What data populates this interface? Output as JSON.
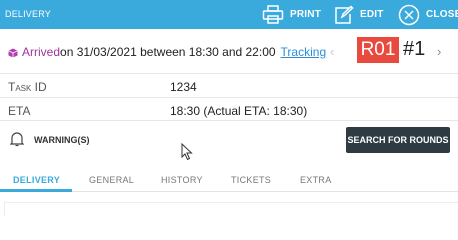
{
  "header": {
    "title": "DELIVERY",
    "print_label": "PRINT",
    "edit_label": "EDIT",
    "close_label": "CLOSE"
  },
  "status": {
    "state": "Arrived",
    "detail": " on 31/03/2021 between 18:30 and 22:00",
    "tracking_link": "Tracking"
  },
  "route": {
    "badge": "R01",
    "number": "#1",
    "prev_icon": "‹",
    "next_icon": "›"
  },
  "fields": {
    "task_id_label": "Task ID",
    "task_id_value": "1234",
    "eta_label": "ETA",
    "eta_value": "18:30 (Actual ETA: 18:30)"
  },
  "warnings": {
    "label": "WARNING(S)"
  },
  "actions": {
    "search_rounds": "SEARCH FOR ROUNDS"
  },
  "tabs": [
    "DELIVERY",
    "GENERAL",
    "HISTORY",
    "TICKETS",
    "EXTRA"
  ],
  "colors": {
    "header_bg": "#3aa9dc",
    "arrived": "#a0359c",
    "route_badge": "#e84a3e",
    "button_dark": "#2f3b42",
    "link": "#2a8ed8"
  }
}
